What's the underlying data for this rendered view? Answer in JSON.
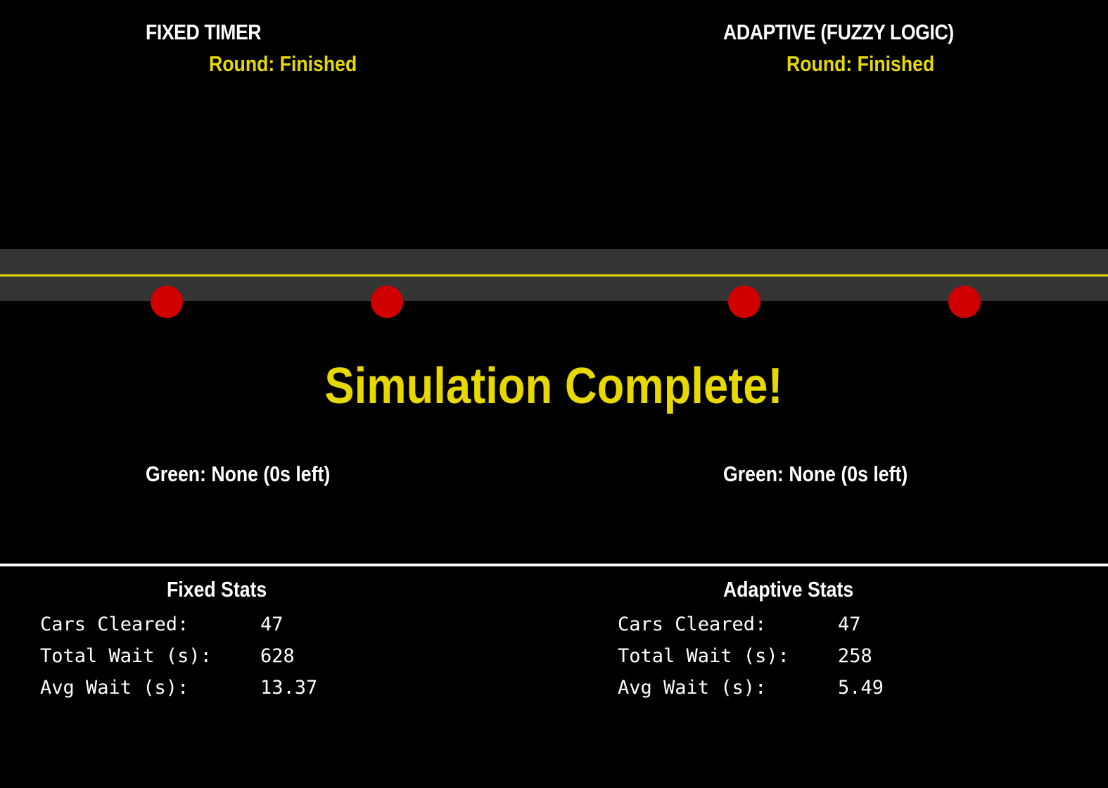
{
  "colors": {
    "background": "#000000",
    "road": "#343434",
    "lane_line": "#e6d800",
    "accent_yellow": "#e6d800",
    "signal_red": "#d00000",
    "text": "#ffffff"
  },
  "fixed_panel": {
    "title": "FIXED TIMER",
    "round_status": "Round: Finished",
    "green_status": "Green: None (0s left)"
  },
  "adaptive_panel": {
    "title": "ADAPTIVE (FUZZY LOGIC)",
    "round_status": "Round: Finished",
    "green_status": "Green: None (0s left)"
  },
  "banner": "Simulation Complete!",
  "traffic_lights": [
    {
      "state": "red"
    },
    {
      "state": "red"
    },
    {
      "state": "red"
    },
    {
      "state": "red"
    }
  ],
  "fixed_stats": {
    "title": "Fixed Stats",
    "rows": [
      {
        "label": "Cars Cleared:",
        "value": "47"
      },
      {
        "label": "Total Wait (s):",
        "value": "628"
      },
      {
        "label": "Avg Wait (s):",
        "value": "13.37"
      }
    ]
  },
  "adaptive_stats": {
    "title": "Adaptive Stats",
    "rows": [
      {
        "label": "Cars Cleared:",
        "value": "47"
      },
      {
        "label": "Total Wait (s):",
        "value": "258"
      },
      {
        "label": "Avg Wait (s):",
        "value": "5.49"
      }
    ]
  }
}
